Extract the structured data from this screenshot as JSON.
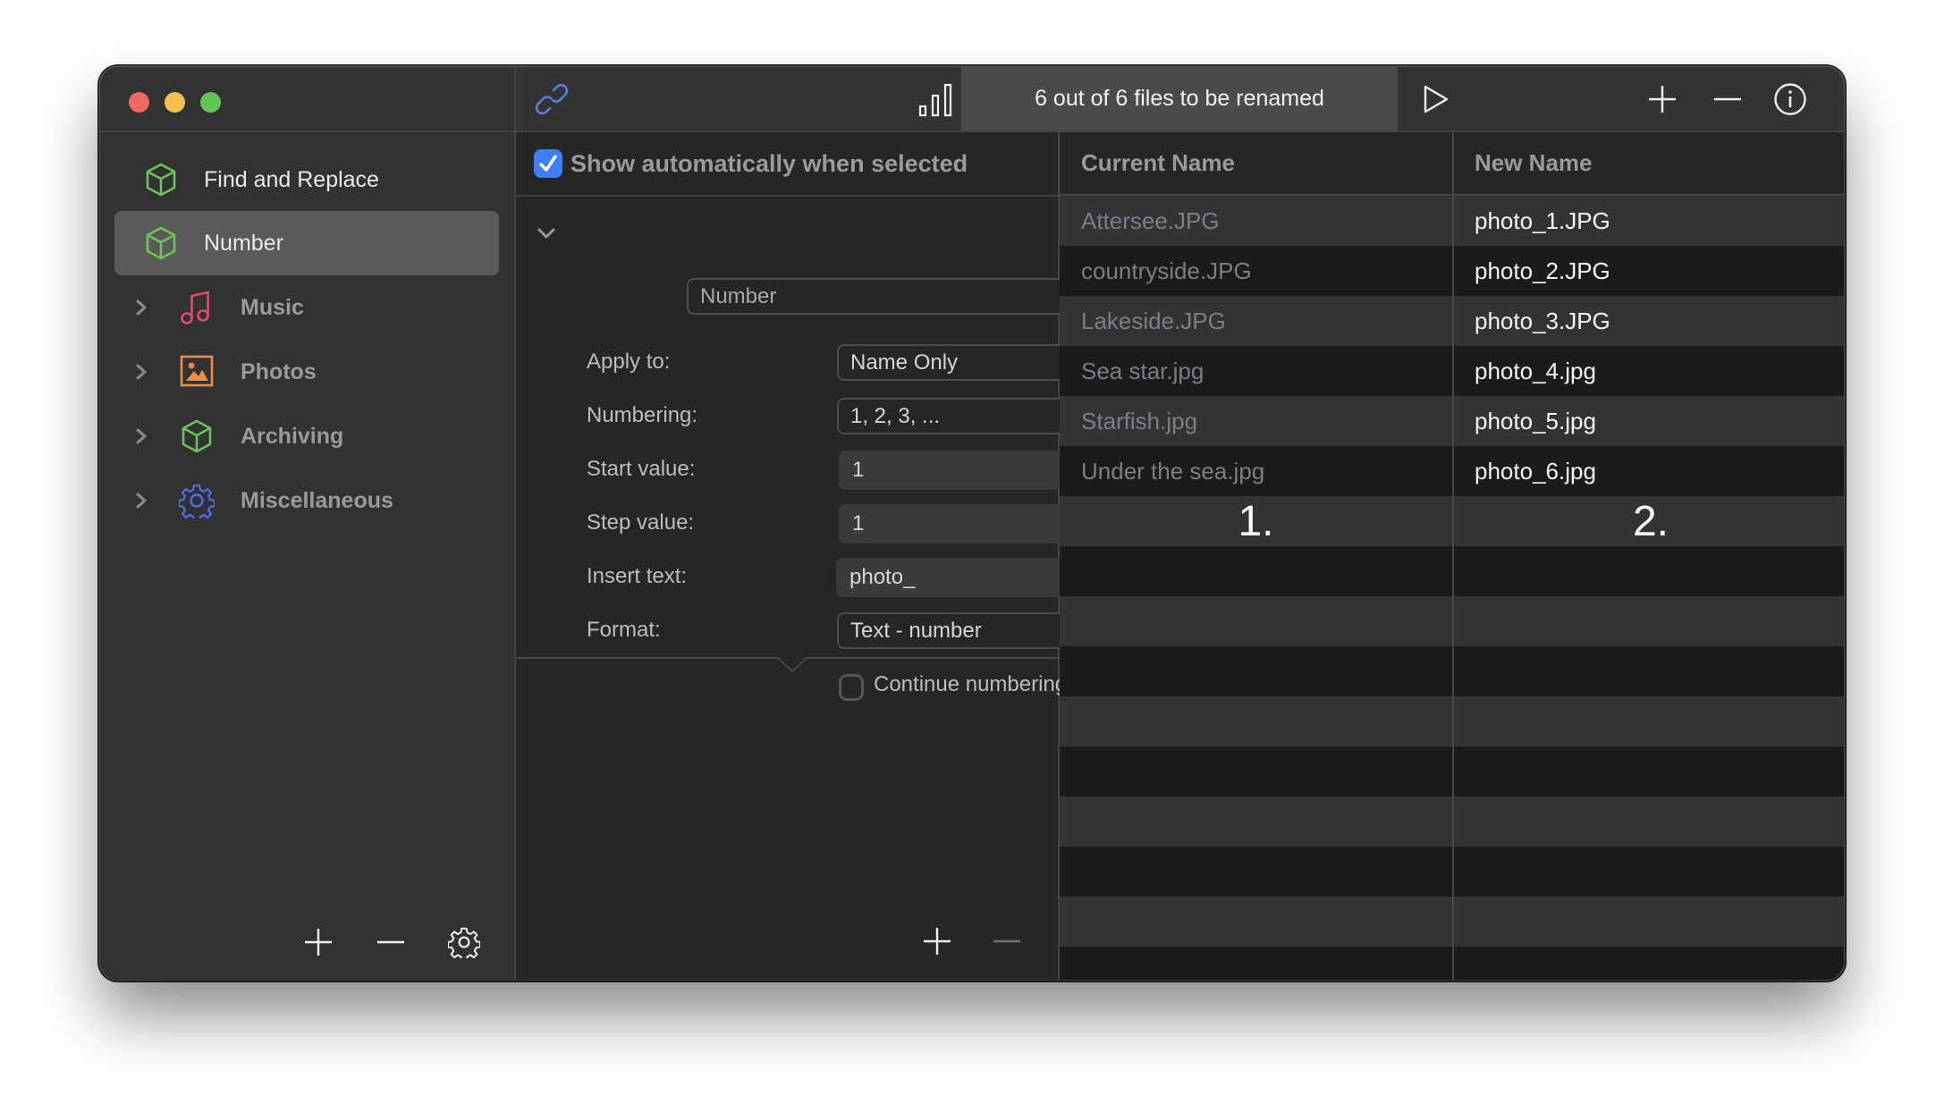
{
  "window": {
    "traffic_lights": [
      "close",
      "minimize",
      "maximize"
    ]
  },
  "toolbar": {
    "link_icon": "link-icon",
    "stats_icon": "bar-chart-icon",
    "status_text": "6 out of 6 files to be renamed",
    "run_icon": "play-icon",
    "add_icon": "plus-icon",
    "remove_icon": "minus-icon",
    "info_icon": "info-icon"
  },
  "sidebar": {
    "items": [
      {
        "label": "Find and Replace",
        "icon": "cube-icon",
        "color": "#6cc35a",
        "selected": false,
        "expandable": false
      },
      {
        "label": "Number",
        "icon": "cube-icon",
        "color": "#6cc35a",
        "selected": true,
        "expandable": false
      },
      {
        "label": "Music",
        "icon": "music-note-icon",
        "color": "#e24a6e",
        "selected": false,
        "expandable": true
      },
      {
        "label": "Photos",
        "icon": "photo-icon",
        "color": "#e78f44",
        "selected": false,
        "expandable": true
      },
      {
        "label": "Archiving",
        "icon": "cube-icon",
        "color": "#6cc35a",
        "selected": false,
        "expandable": true
      },
      {
        "label": "Miscellaneous",
        "icon": "gear-icon",
        "color": "#4a72e6",
        "selected": false,
        "expandable": true
      }
    ],
    "bottom_buttons": [
      "plus-icon",
      "minus-icon",
      "gear-icon"
    ]
  },
  "settings": {
    "show_automatically": {
      "label": "Show automatically when selected",
      "checked": true
    },
    "action_select": "Number",
    "fields": {
      "apply_to": {
        "label": "Apply to:",
        "value": "Name Only"
      },
      "numbering": {
        "label": "Numbering:",
        "value": "1, 2, 3, ..."
      },
      "start_value": {
        "label": "Start value:",
        "value": "1"
      },
      "step_value": {
        "label": "Step value:",
        "value": "1"
      },
      "insert_text": {
        "label": "Insert text:",
        "value": "photo_"
      },
      "format": {
        "label": "Format:",
        "value": "Text - number"
      }
    },
    "continue_numbering": {
      "label": "Continue numbering",
      "checked": false
    },
    "bottom_buttons": [
      "plus-icon",
      "minus-icon"
    ]
  },
  "table": {
    "columns": [
      "Current Name",
      "New Name"
    ],
    "rows": [
      {
        "current": "Attersee.JPG",
        "new": "photo_1.JPG"
      },
      {
        "current": "countryside.JPG",
        "new": "photo_2.JPG"
      },
      {
        "current": "Lakeside.JPG",
        "new": "photo_3.JPG"
      },
      {
        "current": "Sea star.jpg",
        "new": "photo_4.jpg"
      },
      {
        "current": "Starfish.jpg",
        "new": "photo_5.jpg"
      },
      {
        "current": "Under the sea.jpg",
        "new": "photo_6.jpg"
      }
    ],
    "annotations": [
      "1.",
      "2."
    ]
  },
  "colors": {
    "accent": "#3f7ff3",
    "link_icon": "#5a7de0"
  }
}
